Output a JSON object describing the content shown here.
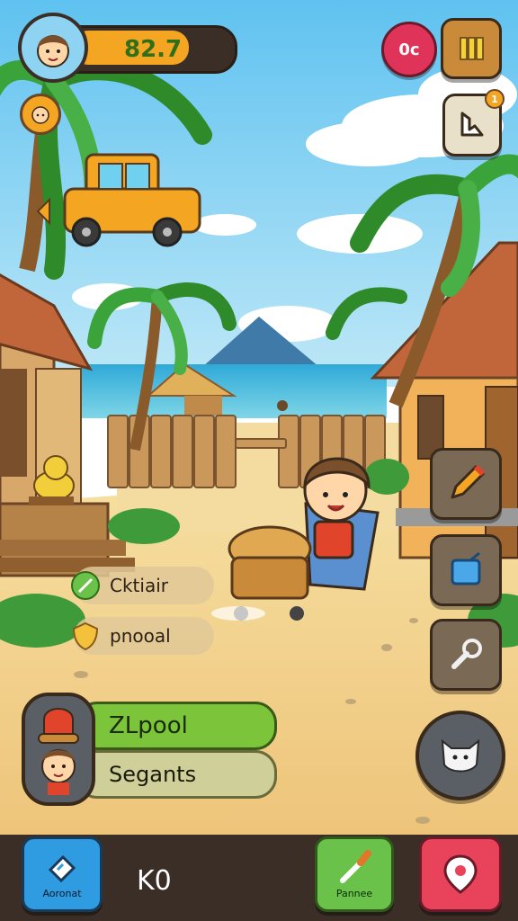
{
  "hud": {
    "level_value": "82.7",
    "top_badge": "0c",
    "quest_badge_count": "1"
  },
  "hints": {
    "hint1": "Cktiair",
    "hint2": "pnooal"
  },
  "player_card": {
    "label_top": "ZLpool",
    "label_bottom": "Segants"
  },
  "bottom_bar": {
    "left_button_label": "Aoronat",
    "center_counter": "K0",
    "right_button_label": "Pannee"
  },
  "colors": {
    "sky": "#8fd3f2",
    "sand": "#f2d28c",
    "hud_gold": "#f4a623",
    "bottom_bar": "#3a2e26"
  }
}
